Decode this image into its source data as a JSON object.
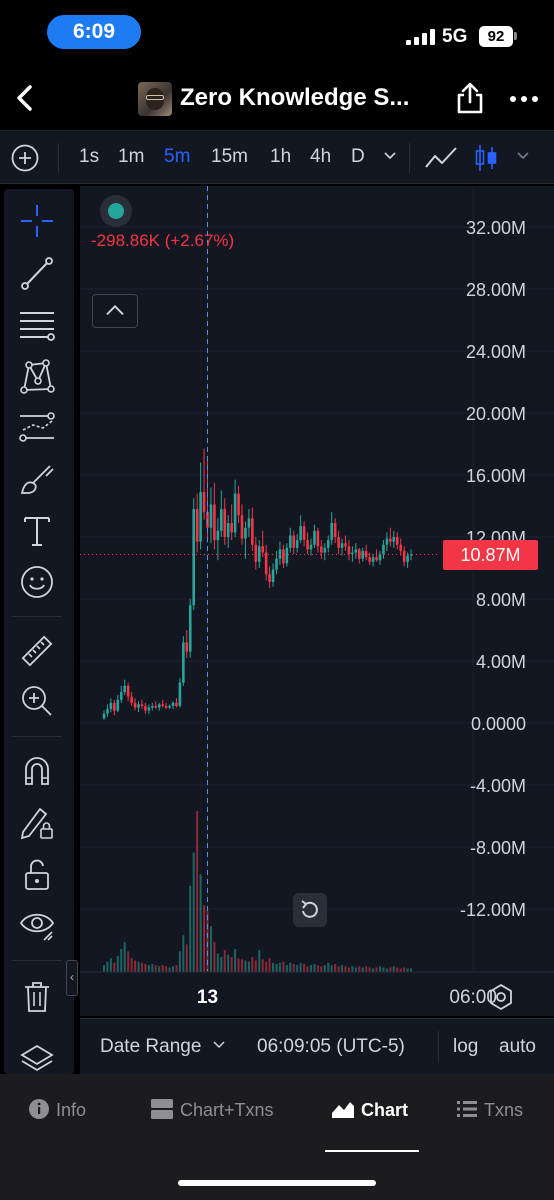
{
  "status_bar": {
    "time": "6:09",
    "network": "5G",
    "battery": "92"
  },
  "header": {
    "title": "Zero Knowledge S..."
  },
  "intervals": [
    {
      "label": "1s",
      "active": false
    },
    {
      "label": "1m",
      "active": false
    },
    {
      "label": "5m",
      "active": true
    },
    {
      "label": "15m",
      "active": false
    },
    {
      "label": "1h",
      "active": false
    },
    {
      "label": "4h",
      "active": false
    },
    {
      "label": "D",
      "active": false
    }
  ],
  "left_tools": [
    "crosshair-icon",
    "trend-line-icon",
    "fib-lines-icon",
    "pattern-icon",
    "prediction-icon",
    "brush-icon",
    "text-icon",
    "emoji-icon",
    "ruler-icon",
    "zoom-in-icon",
    "magnet-icon",
    "lock-drawing-icon",
    "unlock-icon",
    "eye-icon",
    "trash-icon",
    "layers-icon"
  ],
  "legend": {
    "change": "-298.86K (+2.67%)"
  },
  "chart_data": {
    "type": "candlestick",
    "interval": "5m",
    "y_axis": {
      "ticks": [
        "32.00M",
        "28.00M",
        "24.00M",
        "20.00M",
        "16.00M",
        "12.00M",
        "8.00M",
        "4.00M",
        "0.0000",
        "-4.00M",
        "-8.00M",
        "-12.00M"
      ],
      "tick_values": [
        32,
        28,
        24,
        20,
        16,
        12,
        8,
        4,
        0,
        -4,
        -8,
        -12
      ],
      "unit": "M",
      "range": [
        -16,
        35.5
      ]
    },
    "x_axis": {
      "ticks": [
        {
          "label": "13",
          "candle_index": 30
        },
        {
          "label": "06:00",
          "candle_index": 107
        }
      ]
    },
    "last_price": 10.87,
    "last_price_label": "10.87M",
    "crosshair_candle_index": 30,
    "colors": {
      "up": "#26a69a",
      "down": "#f23645",
      "crosshair": "#5b8def"
    },
    "candles": [
      [
        0.3,
        0.8,
        0.2,
        0.6
      ],
      [
        0.6,
        1.2,
        0.4,
        0.9
      ],
      [
        0.9,
        1.6,
        0.7,
        1.3
      ],
      [
        1.3,
        1.5,
        0.5,
        0.8
      ],
      [
        0.8,
        1.8,
        0.7,
        1.5
      ],
      [
        1.5,
        2.4,
        1.3,
        2.0
      ],
      [
        2.0,
        2.8,
        1.8,
        2.4
      ],
      [
        2.4,
        2.6,
        1.4,
        1.7
      ],
      [
        1.7,
        2.0,
        1.1,
        1.3
      ],
      [
        1.3,
        1.6,
        0.8,
        1.0
      ],
      [
        1.0,
        1.4,
        0.7,
        1.2
      ],
      [
        1.2,
        1.5,
        0.9,
        1.1
      ],
      [
        1.1,
        1.3,
        0.6,
        0.8
      ],
      [
        0.8,
        1.2,
        0.6,
        1.0
      ],
      [
        1.0,
        1.3,
        0.8,
        1.1
      ],
      [
        1.1,
        1.4,
        0.9,
        1.0
      ],
      [
        1.0,
        1.3,
        0.8,
        1.2
      ],
      [
        1.2,
        1.5,
        1.0,
        1.1
      ],
      [
        1.1,
        1.3,
        0.9,
        1.0
      ],
      [
        1.0,
        1.2,
        0.9,
        1.1
      ],
      [
        1.1,
        1.4,
        0.9,
        1.3
      ],
      [
        1.3,
        1.6,
        1.0,
        1.1
      ],
      [
        1.1,
        2.9,
        1.0,
        2.6
      ],
      [
        2.6,
        5.6,
        2.4,
        5.2
      ],
      [
        5.2,
        6.0,
        4.2,
        4.6
      ],
      [
        4.6,
        8.0,
        4.2,
        7.6
      ],
      [
        7.6,
        14.5,
        7.3,
        13.8
      ],
      [
        13.8,
        14.8,
        11.0,
        11.7
      ],
      [
        11.7,
        16.8,
        11.2,
        14.9
      ],
      [
        14.9,
        17.7,
        13.1,
        13.6
      ],
      [
        13.6,
        17.2,
        11.8,
        12.6
      ],
      [
        12.6,
        15.2,
        11.6,
        14.1
      ],
      [
        14.1,
        15.5,
        11.2,
        11.8
      ],
      [
        11.8,
        13.2,
        10.5,
        12.4
      ],
      [
        12.4,
        15.0,
        12.0,
        13.8
      ],
      [
        13.8,
        14.5,
        11.5,
        12.0
      ],
      [
        12.0,
        13.4,
        11.3,
        12.9
      ],
      [
        12.9,
        14.1,
        11.8,
        12.3
      ],
      [
        12.3,
        15.7,
        12.0,
        14.8
      ],
      [
        14.8,
        15.3,
        12.9,
        13.4
      ],
      [
        13.4,
        14.1,
        11.5,
        11.9
      ],
      [
        11.9,
        13.0,
        10.6,
        12.6
      ],
      [
        12.6,
        13.8,
        12.0,
        13.2
      ],
      [
        13.2,
        13.9,
        11.1,
        11.5
      ],
      [
        11.5,
        12.0,
        9.9,
        10.4
      ],
      [
        10.4,
        11.8,
        10.0,
        11.4
      ],
      [
        11.4,
        12.4,
        10.7,
        11.0
      ],
      [
        11.0,
        11.5,
        9.2,
        9.6
      ],
      [
        9.6,
        10.1,
        8.7,
        9.1
      ],
      [
        9.1,
        10.3,
        8.8,
        9.9
      ],
      [
        9.9,
        11.1,
        9.6,
        10.6
      ],
      [
        10.6,
        11.7,
        10.2,
        11.2
      ],
      [
        11.2,
        11.5,
        10.0,
        10.3
      ],
      [
        10.3,
        11.6,
        10.1,
        11.3
      ],
      [
        11.3,
        12.6,
        11.0,
        12.1
      ],
      [
        12.1,
        12.4,
        10.9,
        11.3
      ],
      [
        11.3,
        12.2,
        11.0,
        11.8
      ],
      [
        11.8,
        13.4,
        11.6,
        12.7
      ],
      [
        12.7,
        13.0,
        11.4,
        11.8
      ],
      [
        11.8,
        12.3,
        10.9,
        11.2
      ],
      [
        11.2,
        11.9,
        10.8,
        11.5
      ],
      [
        11.5,
        12.8,
        11.3,
        12.4
      ],
      [
        12.4,
        12.6,
        11.0,
        11.4
      ],
      [
        11.4,
        11.8,
        10.6,
        11.0
      ],
      [
        11.0,
        11.6,
        10.5,
        11.3
      ],
      [
        11.3,
        12.1,
        11.0,
        11.8
      ],
      [
        11.8,
        13.6,
        11.5,
        12.9
      ],
      [
        12.9,
        13.2,
        11.6,
        12.0
      ],
      [
        12.0,
        12.4,
        10.9,
        11.3
      ],
      [
        11.3,
        11.9,
        10.8,
        11.6
      ],
      [
        11.6,
        12.1,
        11.1,
        11.4
      ],
      [
        11.4,
        11.8,
        10.5,
        10.9
      ],
      [
        10.9,
        11.4,
        10.4,
        11.0
      ],
      [
        11.0,
        11.6,
        10.6,
        11.2
      ],
      [
        11.2,
        11.3,
        10.3,
        10.6
      ],
      [
        10.6,
        11.3,
        10.4,
        11.1
      ],
      [
        11.1,
        11.5,
        10.5,
        10.7
      ],
      [
        10.7,
        11.0,
        10.2,
        10.4
      ],
      [
        10.4,
        10.9,
        10.1,
        10.7
      ],
      [
        10.7,
        11.2,
        10.4,
        10.5
      ],
      [
        10.5,
        11.1,
        10.2,
        10.9
      ],
      [
        10.9,
        11.8,
        10.6,
        11.5
      ],
      [
        11.5,
        12.3,
        11.1,
        11.9
      ],
      [
        11.9,
        12.6,
        11.4,
        11.7
      ],
      [
        11.7,
        12.4,
        11.3,
        12.0
      ],
      [
        12.0,
        12.3,
        11.2,
        11.5
      ],
      [
        11.5,
        11.9,
        10.8,
        11.1
      ],
      [
        11.1,
        11.4,
        10.1,
        10.4
      ],
      [
        10.4,
        11.0,
        10.0,
        10.8
      ],
      [
        10.8,
        11.2,
        10.5,
        10.87
      ]
    ],
    "volume": [
      0.6,
      0.9,
      1.2,
      0.8,
      1.4,
      2.0,
      2.6,
      1.8,
      1.2,
      1.0,
      0.9,
      0.8,
      0.7,
      0.6,
      0.7,
      0.6,
      0.5,
      0.6,
      0.5,
      0.4,
      0.5,
      0.6,
      1.8,
      3.2,
      2.4,
      7.5,
      10.4,
      14.0,
      8.5,
      5.8,
      5.3,
      4.0,
      2.6,
      1.6,
      1.3,
      1.9,
      1.5,
      1.3,
      2.0,
      1.2,
      1.1,
      1.0,
      0.9,
      1.3,
      1.0,
      1.9,
      1.1,
      0.9,
      1.2,
      0.8,
      0.7,
      0.8,
      0.9,
      0.6,
      0.8,
      0.7,
      0.6,
      0.8,
      0.7,
      0.5,
      0.6,
      0.7,
      0.6,
      0.5,
      0.6,
      0.8,
      0.6,
      0.7,
      0.5,
      0.6,
      0.5,
      0.4,
      0.5,
      0.4,
      0.5,
      0.4,
      0.5,
      0.4,
      0.3,
      0.4,
      0.5,
      0.4,
      0.3,
      0.4,
      0.5,
      0.4,
      0.3,
      0.4,
      0.3,
      0.3
    ]
  },
  "chart_controls": {
    "date_range": "Date Range",
    "clock": "06:09:05 (UTC-5)",
    "log": "log",
    "auto": "auto"
  },
  "nav": [
    {
      "label": "Info",
      "icon": "info-icon",
      "active": false
    },
    {
      "label": "Chart+Txns",
      "icon": "chart-txns-icon",
      "active": false
    },
    {
      "label": "Chart",
      "icon": "chart-icon",
      "active": true
    },
    {
      "label": "Txns",
      "icon": "list-icon",
      "active": false
    }
  ]
}
